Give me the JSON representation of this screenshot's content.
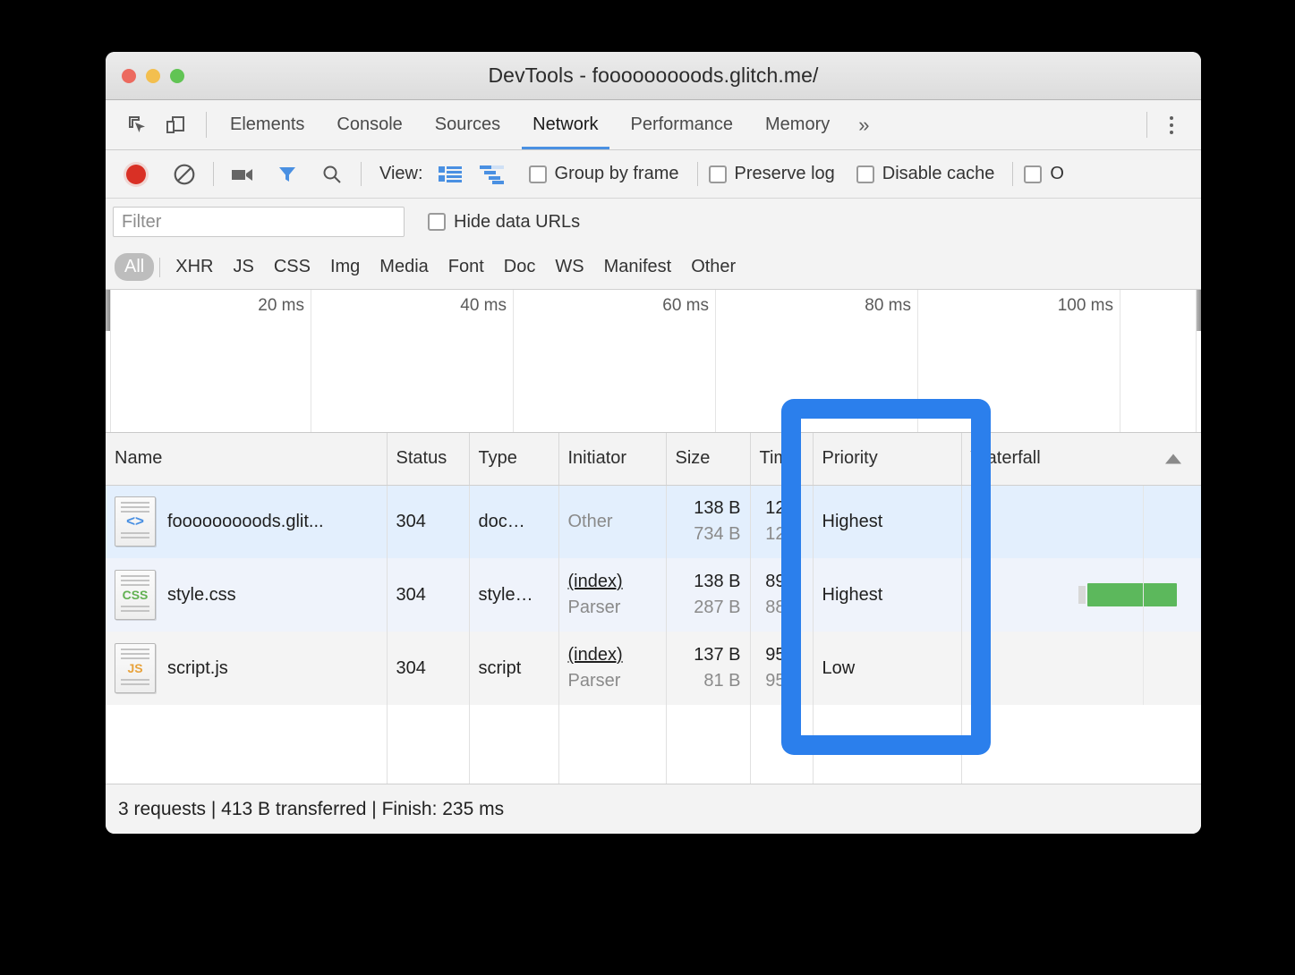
{
  "window": {
    "title": "DevTools - fooooooooods.glitch.me/",
    "traffic_lights": [
      "close",
      "minimize",
      "maximize"
    ]
  },
  "tabbar": {
    "icons": [
      {
        "name": "inspect-element-icon"
      },
      {
        "name": "device-toolbar-icon"
      }
    ],
    "tabs": [
      {
        "label": "Elements",
        "active": false
      },
      {
        "label": "Console",
        "active": false
      },
      {
        "label": "Sources",
        "active": false
      },
      {
        "label": "Network",
        "active": true
      },
      {
        "label": "Performance",
        "active": false
      },
      {
        "label": "Memory",
        "active": false
      }
    ],
    "more_label": "»",
    "kebab": "more-options"
  },
  "network_toolbar": {
    "record_button": "record-icon",
    "clear_button": "clear-icon",
    "screenshot_button": "camera-icon",
    "filter_button": "filter-icon",
    "search_button": "search-icon",
    "view_label": "View:",
    "view_list_icon": "list-view-icon",
    "view_waterfall_icon": "waterfall-view-icon",
    "checkboxes": [
      {
        "label": "Group by frame",
        "checked": false
      },
      {
        "label": "Preserve log",
        "checked": false
      },
      {
        "label": "Disable cache",
        "checked": false
      },
      {
        "label": "O",
        "checked": false
      }
    ]
  },
  "filter_bar": {
    "placeholder": "Filter",
    "value": "",
    "hide_data_urls": {
      "label": "Hide data URLs",
      "checked": false
    }
  },
  "type_chips": {
    "items": [
      "All",
      "XHR",
      "JS",
      "CSS",
      "Img",
      "Media",
      "Font",
      "Doc",
      "WS",
      "Manifest",
      "Other"
    ],
    "active": "All"
  },
  "overview": {
    "ticks": [
      "20 ms",
      "40 ms",
      "60 ms",
      "80 ms",
      "100 ms"
    ]
  },
  "table": {
    "headers": [
      "Name",
      "Status",
      "Type",
      "Initiator",
      "Size",
      "Time",
      "Priority",
      "Waterfall"
    ],
    "sort_indicator": "ascending",
    "rows": [
      {
        "name": "fooooooooods.glit...",
        "icon": "document-file-icon",
        "icon_badge": "<>",
        "status": "304",
        "type": "doc…",
        "initiator_top": "Other",
        "initiator_bot": "",
        "initiator_is_link": false,
        "size_top": "138 B",
        "size_bot": "734 B",
        "time_top": "12…",
        "time_bot": "12…",
        "priority": "Highest",
        "waterfall_bar": true,
        "state": "selected"
      },
      {
        "name": "style.css",
        "icon": "css-file-icon",
        "icon_badge": "CSS",
        "status": "304",
        "type": "style…",
        "initiator_top": "(index)",
        "initiator_bot": "Parser",
        "initiator_is_link": true,
        "size_top": "138 B",
        "size_bot": "287 B",
        "time_top": "89…",
        "time_bot": "88…",
        "priority": "Highest",
        "waterfall_bar": true,
        "state": "alt"
      },
      {
        "name": "script.js",
        "icon": "js-file-icon",
        "icon_badge": "JS",
        "status": "304",
        "type": "script",
        "initiator_top": "(index)",
        "initiator_bot": "Parser",
        "initiator_is_link": true,
        "size_top": "137 B",
        "size_bot": "81 B",
        "time_top": "95…",
        "time_bot": "95…",
        "priority": "Low",
        "waterfall_bar": false,
        "state": "plain"
      }
    ]
  },
  "statusbar": {
    "text": "3 requests | 413 B transferred | Finish: 235 ms"
  },
  "annotation": {
    "type": "highlight-rectangle",
    "target": "priority-column",
    "color": "#2b7fec"
  }
}
